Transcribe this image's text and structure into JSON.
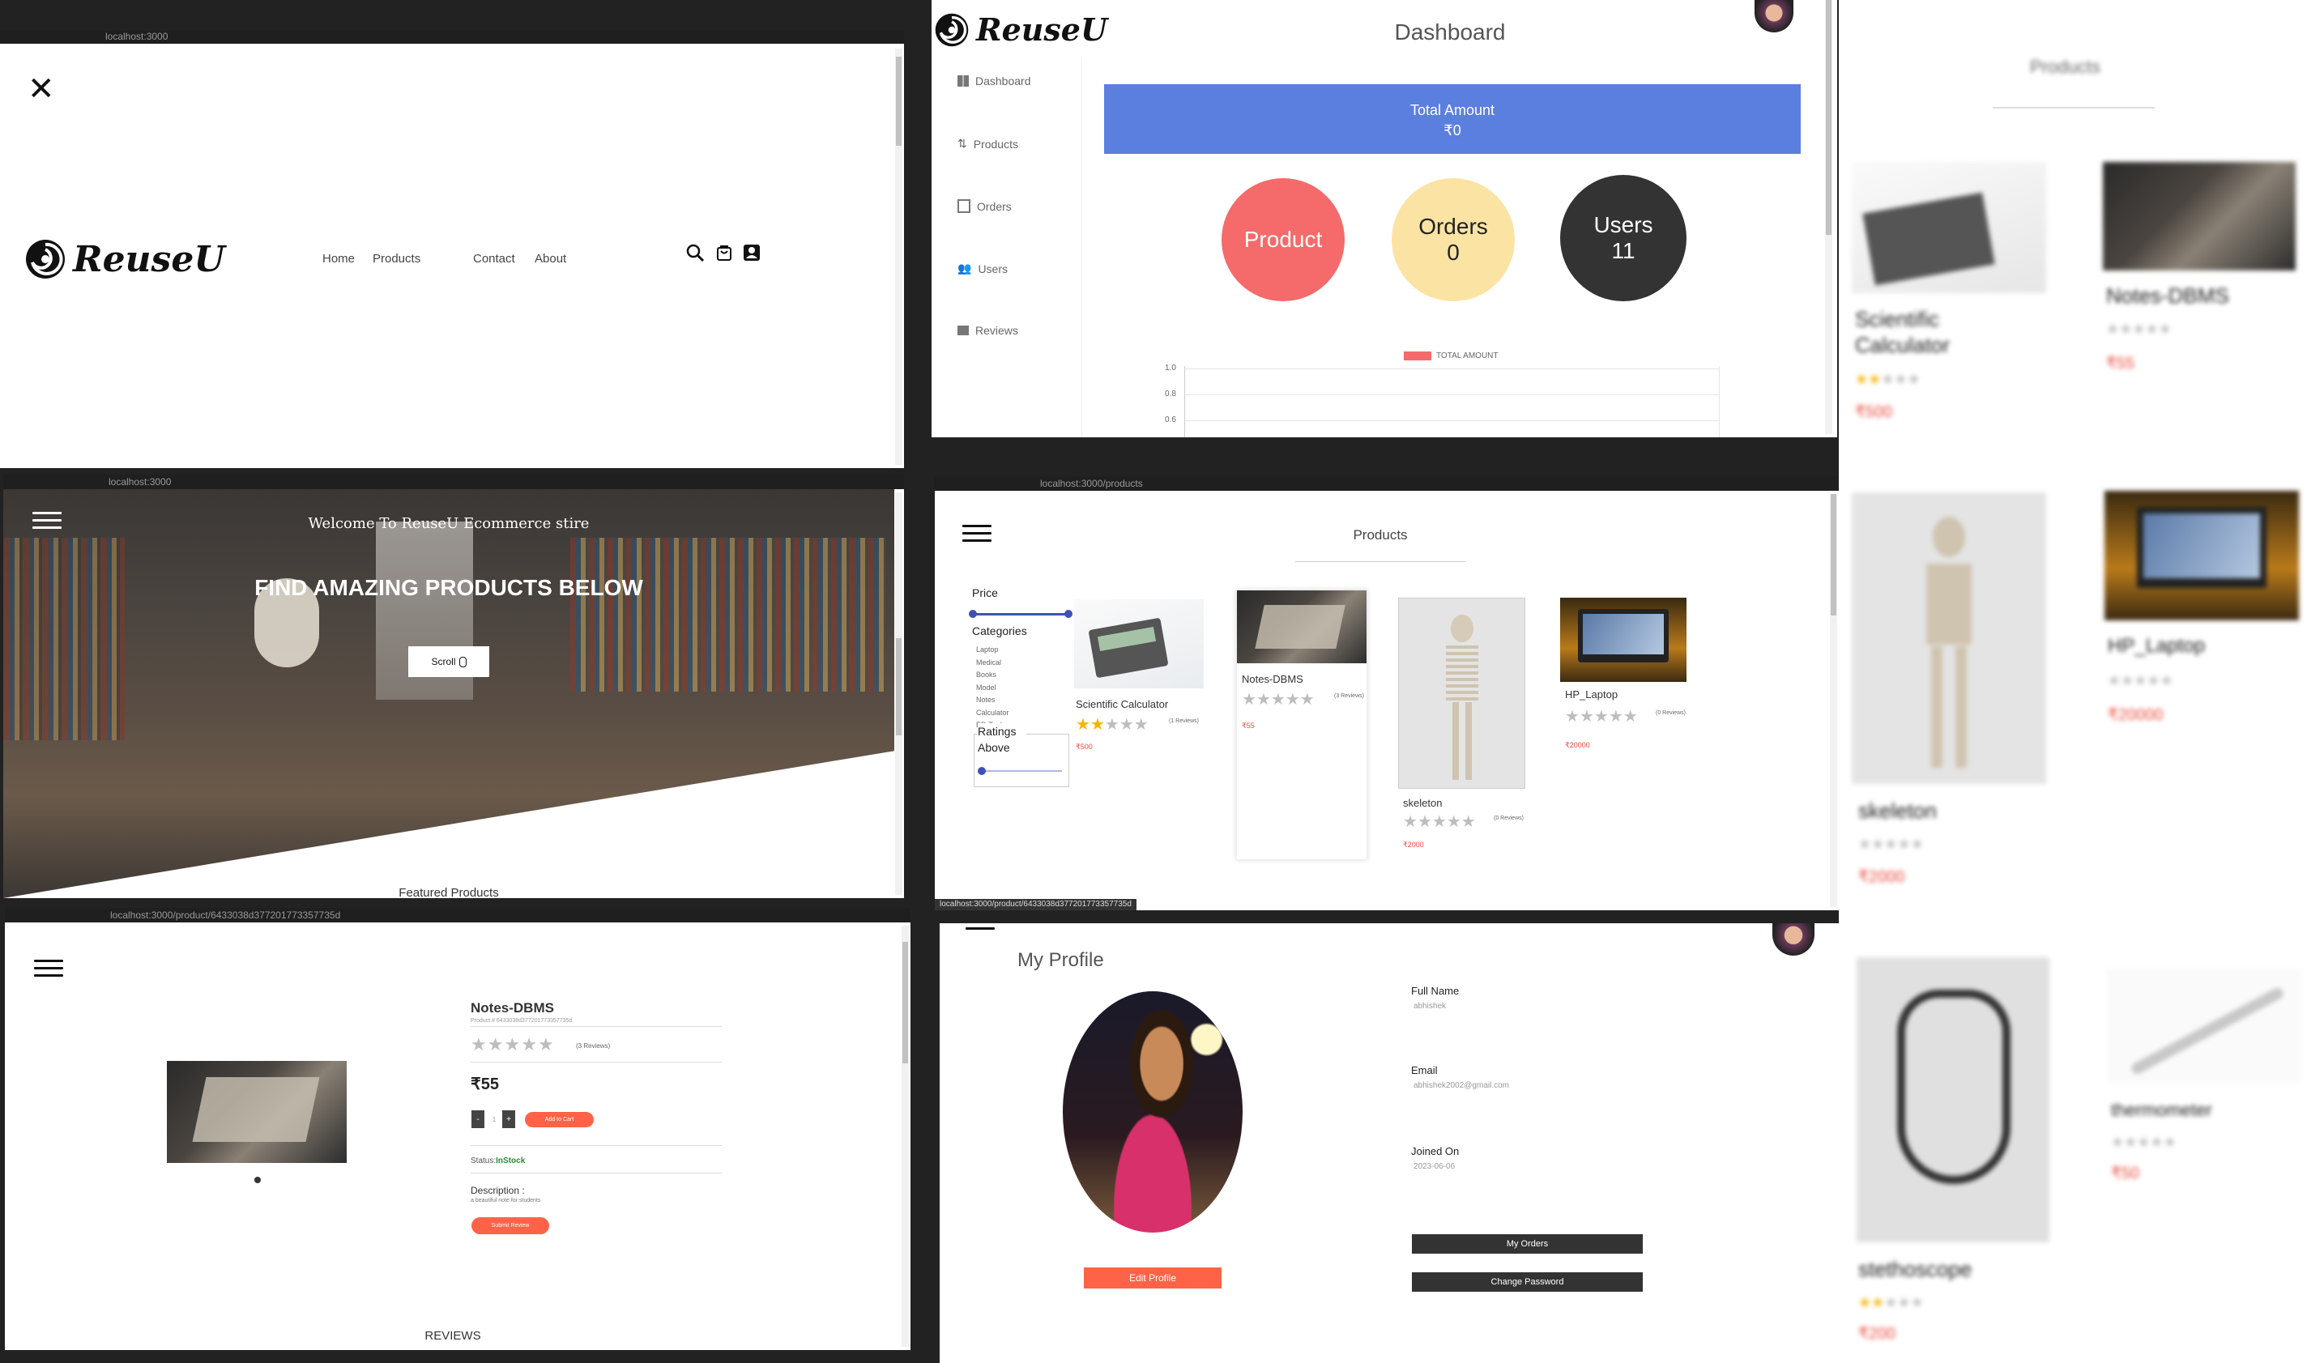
{
  "panel1": {
    "url": "localhost:3000",
    "logo_text": "ReuseU",
    "nav": [
      "Home",
      "Products",
      "Contact",
      "About"
    ]
  },
  "panel2": {
    "url": "localhost:3000",
    "welcome": "Welcome To ReuseU Ecommerce stire",
    "headline": "FIND AMAZING PRODUCTS BELOW",
    "scroll_label": "Scroll",
    "featured": "Featured Products"
  },
  "panel3": {
    "url": "localhost:3000/product/6433038d377201773357735d",
    "name": "Notes-DBMS",
    "product_id": "Product # 6433038d377201773357735d",
    "reviews": "(3 Reviews)",
    "price": "₹55",
    "qty": "1",
    "minus": "-",
    "plus": "+",
    "add_to_cart": "Add to Cart",
    "status_label": "Status:",
    "status_value": "InStock",
    "description_label": "Description :",
    "description": "a beautiful note for students",
    "submit_review": "Submit Review",
    "reviews_heading": "REVIEWS"
  },
  "dashboard": {
    "logo_text": "ReuseU",
    "title": "Dashboard",
    "sidebar": [
      "Dashboard",
      "Products",
      "Orders",
      "Users",
      "Reviews"
    ],
    "total_label": "Total Amount",
    "total_value": "₹0",
    "circle_product": "Product",
    "circle_orders": "Orders",
    "circle_orders_value": "0",
    "circle_users": "Users",
    "circle_users_value": "11",
    "legend": "TOTAL AMOUNT",
    "yticks": [
      "1.0",
      "0.8",
      "0.6"
    ]
  },
  "products_page": {
    "url": "localhost:3000/products",
    "title": "Products",
    "price_label": "Price",
    "categories_label": "Categories",
    "categories": [
      "Laptop",
      "Medical",
      "Books",
      "Model",
      "Notes",
      "Calculator",
      "ED-Tools"
    ],
    "ratings_label": "Ratings Above",
    "status_url": "localhost:3000/product/6433038d377201773357735d",
    "items": [
      {
        "name": "Scientific Calculator",
        "reviews": "(1 Reviews)",
        "price": "₹500",
        "rating": 2
      },
      {
        "name": "Notes-DBMS",
        "reviews": "(3 Reviews)",
        "price": "₹55",
        "rating": 0
      },
      {
        "name": "skeleton",
        "reviews": "(0 Reviews)",
        "price": "₹2000",
        "rating": 0
      },
      {
        "name": "HP_Laptop",
        "reviews": "(0 Reviews)",
        "price": "₹20000",
        "rating": 0
      }
    ]
  },
  "profile": {
    "title": "My Profile",
    "full_name_label": "Full Name",
    "full_name": "abhishek",
    "email_label": "Email",
    "email": "abhishek2002@gmail.com",
    "joined_label": "Joined On",
    "joined": "2023-06-06",
    "edit_profile": "Edit Profile",
    "my_orders": "My Orders",
    "change_password": "Change Password"
  },
  "zoomed": {
    "title": "Products",
    "items": [
      {
        "name": "Scientific Calculator",
        "price": "₹500"
      },
      {
        "name": "Notes-DBMS",
        "price": "₹55"
      },
      {
        "name": "skeleton",
        "price": "₹2000"
      },
      {
        "name": "HP_Laptop",
        "price": "₹20000"
      },
      {
        "name": "stethoscope",
        "price": "₹200"
      },
      {
        "name": "thermometer",
        "price": "₹50"
      }
    ]
  },
  "colors": {
    "accent": "#ff6347",
    "dashboard_blue": "#5b7fde",
    "product_circle": "#f56a6a",
    "orders_circle": "#fbe3a3",
    "users_circle": "#333333",
    "slider": "#3f51b5"
  }
}
